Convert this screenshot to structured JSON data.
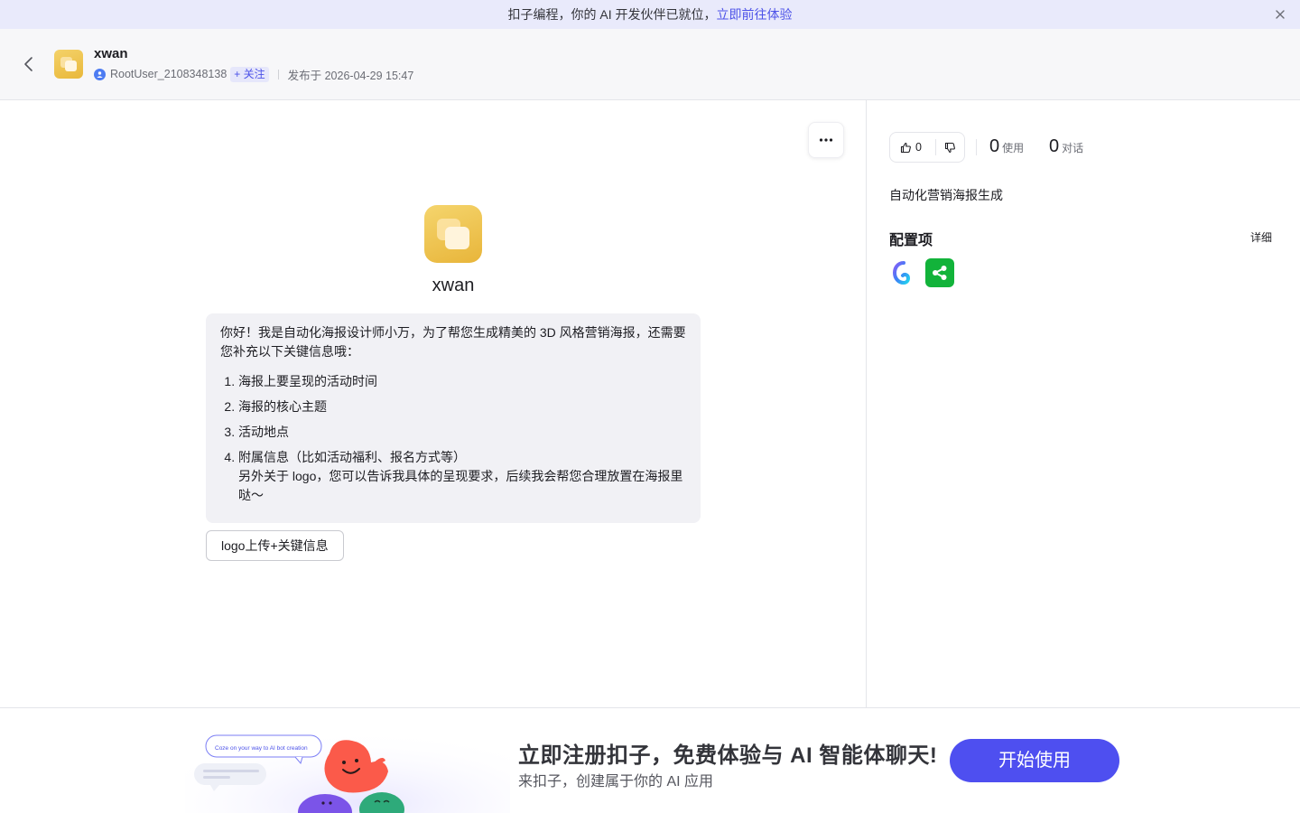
{
  "banner": {
    "text": "扣子编程，你的 AI 开发伙伴已就位，",
    "link": "立即前往体验"
  },
  "header": {
    "bot_name": "xwan",
    "username": "RootUser_2108348138",
    "follow_label": "+ 关注",
    "published": "发布于 2026-04-29 15:47"
  },
  "chat": {
    "bot_name": "xwan",
    "message_intro": "你好！我是自动化海报设计师小万，为了帮您生成精美的 3D 风格营销海报，还需要您补充以下关键信息哦：",
    "message_items": [
      "海报上要呈现的活动时间",
      "海报的核心主题",
      "活动地点",
      "附属信息（比如活动福利、报名方式等）"
    ],
    "message_outro": "另外关于 logo，您可以告诉我具体的呈现要求，后续我会帮您合理放置在海报里哒～",
    "suggestion": "logo上传+关键信息"
  },
  "side": {
    "likes": "0",
    "uses": "0",
    "uses_label": "使用",
    "chats": "0",
    "chats_label": "对话",
    "description": "自动化营销海报生成",
    "config_title": "配置项",
    "detail_label": "详细",
    "plugins": [
      "coze-model-icon",
      "share-plugin-icon"
    ]
  },
  "footer": {
    "bubble_text": "Coze on your way to AI bot creation",
    "title": "立即注册扣子，免费体验与 AI 智能体聊天!",
    "subtitle": "来扣子，创建属于你的 AI 应用",
    "cta": "开始使用"
  },
  "colors": {
    "accent": "#4d53e8",
    "cta": "#4e4ff0",
    "plugin_green": "#12b33a",
    "avatar_yellow": "#f0c84f"
  }
}
